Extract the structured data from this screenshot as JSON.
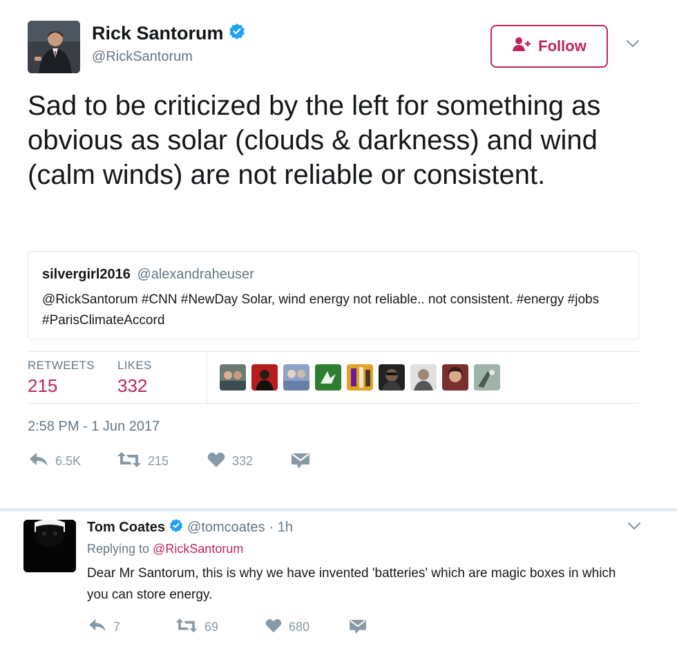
{
  "tweet": {
    "display_name": "Rick Santorum",
    "handle": "@RickSantorum",
    "follow_label": "Follow",
    "text": "Sad to be criticized by the left for something as obvious as solar (clouds & darkness) and wind (calm winds) are not reliable or consistent.",
    "quote": {
      "name": "silvergirl2016",
      "handle": "@alexandraheuser",
      "text": "@RickSantorum #CNN #NewDay Solar, wind energy not reliable.. not consistent. #energy #jobs #ParisClimateAccord"
    },
    "stats": {
      "retweets_label": "RETWEETS",
      "retweets_value": "215",
      "likes_label": "LIKES",
      "likes_value": "332"
    },
    "timestamp": "2:58 PM - 1 Jun 2017",
    "actions": {
      "reply_count": "6.5K",
      "retweet_count": "215",
      "like_count": "332"
    }
  },
  "reply": {
    "display_name": "Tom Coates",
    "handle": "@tomcoates",
    "time": "· 1h",
    "replying_prefix": "Replying to",
    "replying_to": "@RickSantorum",
    "text": "Dear Mr Santorum, this is why we have invented 'batteries' which are magic boxes in which you can store energy.",
    "actions": {
      "reply_count": "7",
      "retweet_count": "69",
      "like_count": "680"
    }
  },
  "colors": {
    "accent": "#c0245c",
    "verified": "#1da1f2",
    "muted": "#657786",
    "icon": "#8899a6",
    "border": "#e1e8ed"
  },
  "icons": [
    "verified-badge-icon",
    "follow-person-icon",
    "chevron-down-icon",
    "reply-icon",
    "retweet-icon",
    "heart-icon",
    "direct-message-icon"
  ]
}
